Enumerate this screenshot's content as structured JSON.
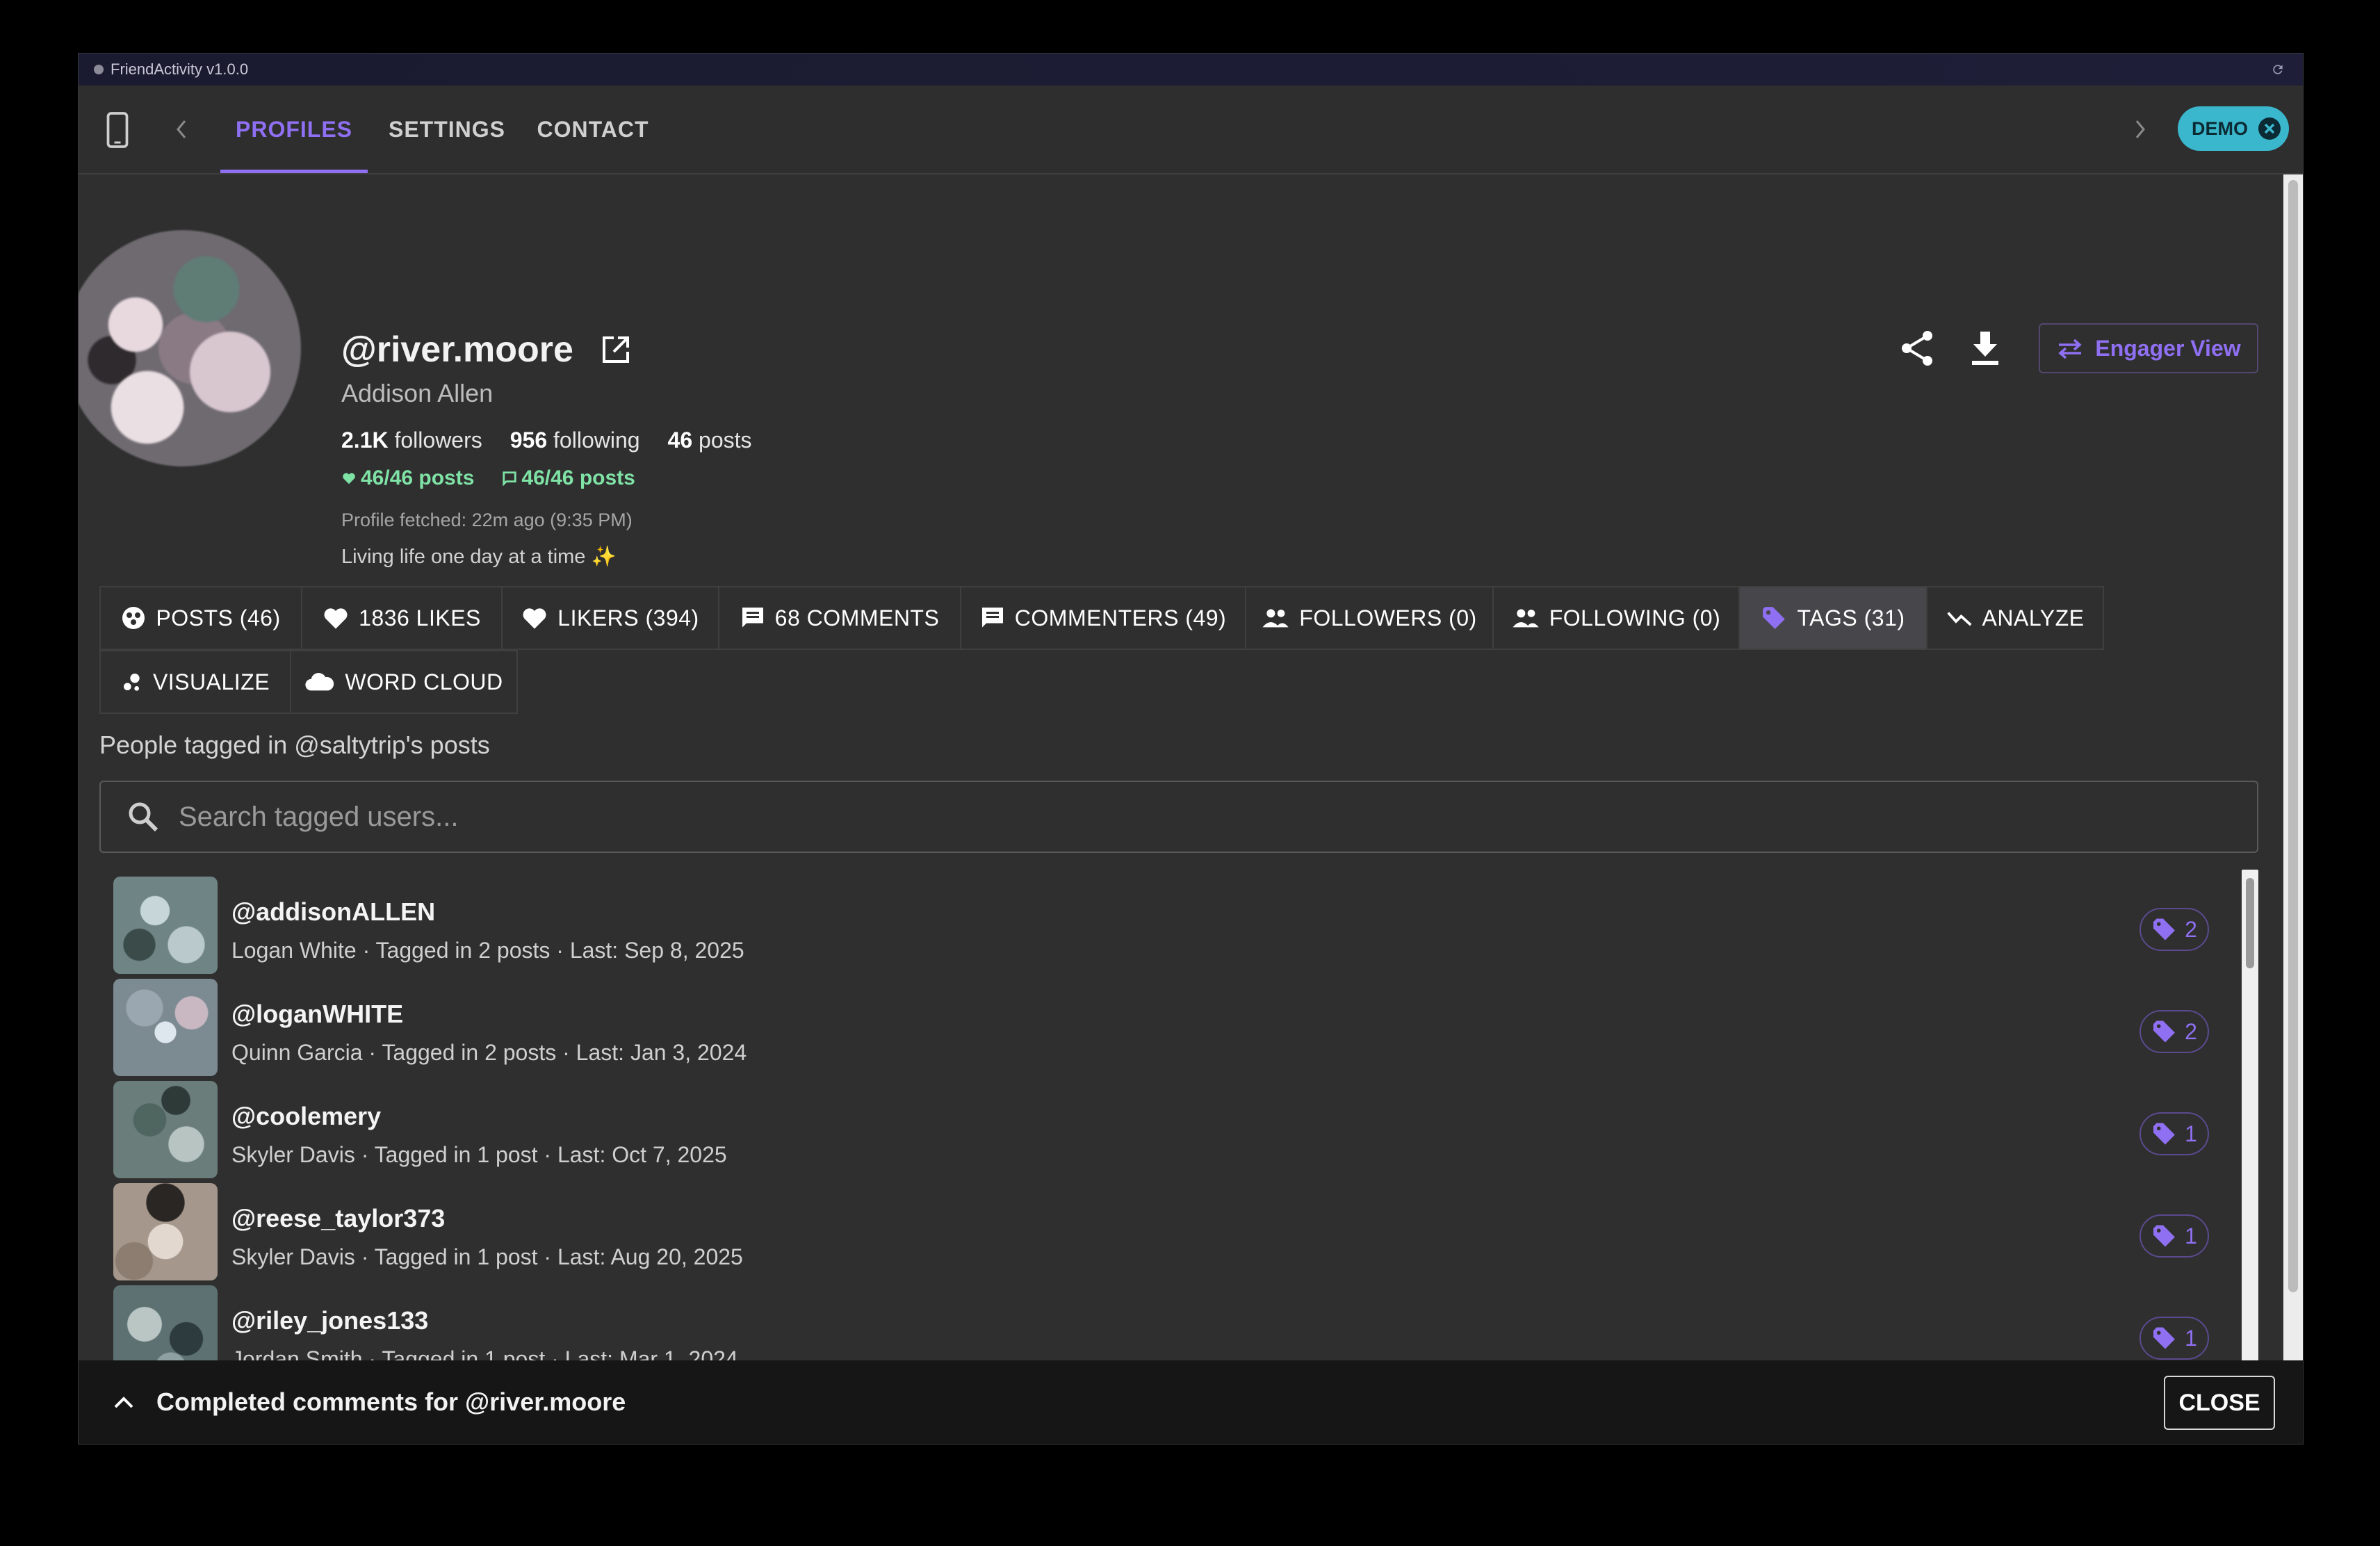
{
  "window": {
    "title": "FriendActivity v1.0.0"
  },
  "nav": {
    "tabs": [
      "PROFILES",
      "SETTINGS",
      "CONTACT"
    ],
    "active_tab": "PROFILES",
    "demo_label": "DEMO"
  },
  "profile": {
    "handle": "@river.moore",
    "display_name": "Addison Allen",
    "followers_count": "2.1K",
    "followers_label": "followers",
    "following_count": "956",
    "following_label": "following",
    "posts_count": "46",
    "posts_label": "posts",
    "likes_progress": "46/46 posts",
    "comments_progress": "46/46 posts",
    "fetched": "Profile fetched: 22m ago (9:35 PM)",
    "bio": "Living life one day at a time ✨",
    "engager_view_label": "Engager View"
  },
  "tabs": [
    {
      "label": "POSTS (46)",
      "icon": "posts-icon"
    },
    {
      "label": "1836 LIKES",
      "icon": "heart-icon"
    },
    {
      "label": "LIKERS (394)",
      "icon": "heart-icon"
    },
    {
      "label": "68 COMMENTS",
      "icon": "comment-icon"
    },
    {
      "label": "COMMENTERS (49)",
      "icon": "comment-icon"
    },
    {
      "label": "FOLLOWERS (0)",
      "icon": "people-icon"
    },
    {
      "label": "FOLLOWING (0)",
      "icon": "people-icon"
    },
    {
      "label": "TAGS (31)",
      "icon": "tag-icon",
      "active": true
    },
    {
      "label": "ANALYZE",
      "icon": "trend-icon"
    },
    {
      "label": "VISUALIZE",
      "icon": "bubbles-icon"
    },
    {
      "label": "WORD CLOUD",
      "icon": "cloud-icon"
    }
  ],
  "tagged": {
    "heading": "People tagged in @saltytrip's posts",
    "search_placeholder": "Search tagged users...",
    "users": [
      {
        "handle": "@addisonALLEN",
        "meta": "Logan White · Tagged in 2 posts · Last: Sep 8, 2025",
        "count": "2"
      },
      {
        "handle": "@loganWHITE",
        "meta": "Quinn Garcia · Tagged in 2 posts · Last: Jan 3, 2024",
        "count": "2"
      },
      {
        "handle": "@coolemery",
        "meta": "Skyler Davis · Tagged in 1 post · Last: Oct 7, 2025",
        "count": "1"
      },
      {
        "handle": "@reese_taylor373",
        "meta": "Skyler Davis · Tagged in 1 post · Last: Aug 20, 2025",
        "count": "1"
      },
      {
        "handle": "@riley_jones133",
        "meta": "Jordan Smith · Tagged in 1 post · Last: Mar 1, 2024",
        "count": "1"
      }
    ]
  },
  "snackbar": {
    "message": "Completed comments for @river.moore",
    "close_label": "CLOSE"
  },
  "colors": {
    "accent": "#8f6ff2",
    "demo_chip": "#3ab7cc",
    "progress_green": "#7fe3a6",
    "background": "#2f2f2f"
  }
}
